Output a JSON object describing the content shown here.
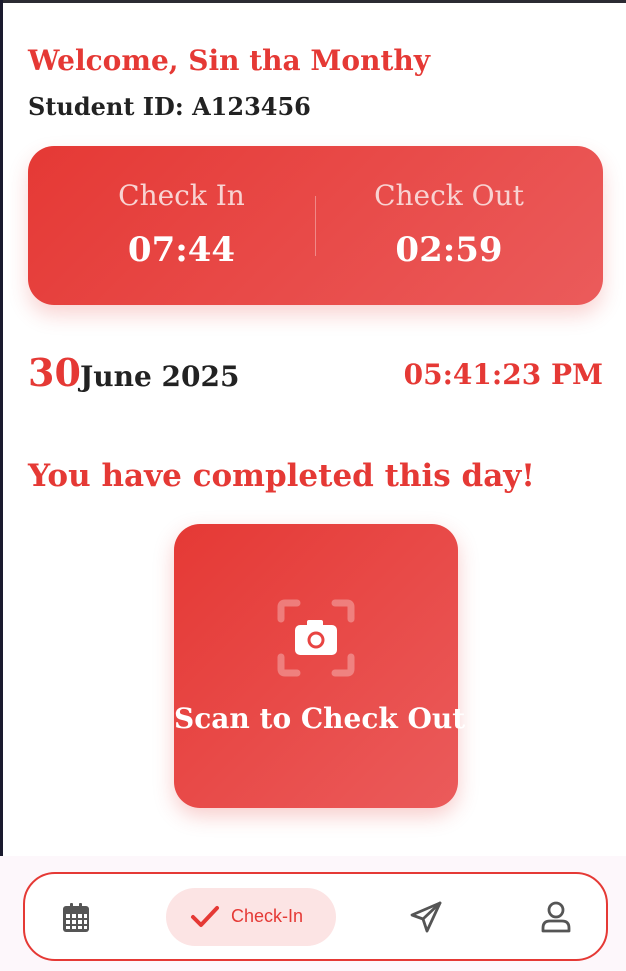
{
  "header": {
    "welcome": "Welcome, Sin tha Monthy",
    "student_id": "Student ID: A123456"
  },
  "time_card": {
    "check_in_label": "Check In",
    "check_in_time": "07:44",
    "check_out_label": "Check Out",
    "check_out_time": "02:59"
  },
  "date": {
    "day": "30",
    "month_year": "June 2025",
    "clock": "05:41:23 PM"
  },
  "status_message": "You have completed this day!",
  "scan_button": {
    "label": "Scan to Check Out",
    "icon": "camera-scan-icon"
  },
  "bottom_nav": {
    "items": [
      {
        "icon": "calendar-icon",
        "label": ""
      },
      {
        "icon": "check-icon",
        "label": "Check-In",
        "active": true
      },
      {
        "icon": "send-icon",
        "label": ""
      },
      {
        "icon": "profile-icon",
        "label": ""
      }
    ]
  },
  "colors": {
    "accent": "#e53935",
    "accent_light": "#fce4e4",
    "text_dark": "#222222"
  }
}
